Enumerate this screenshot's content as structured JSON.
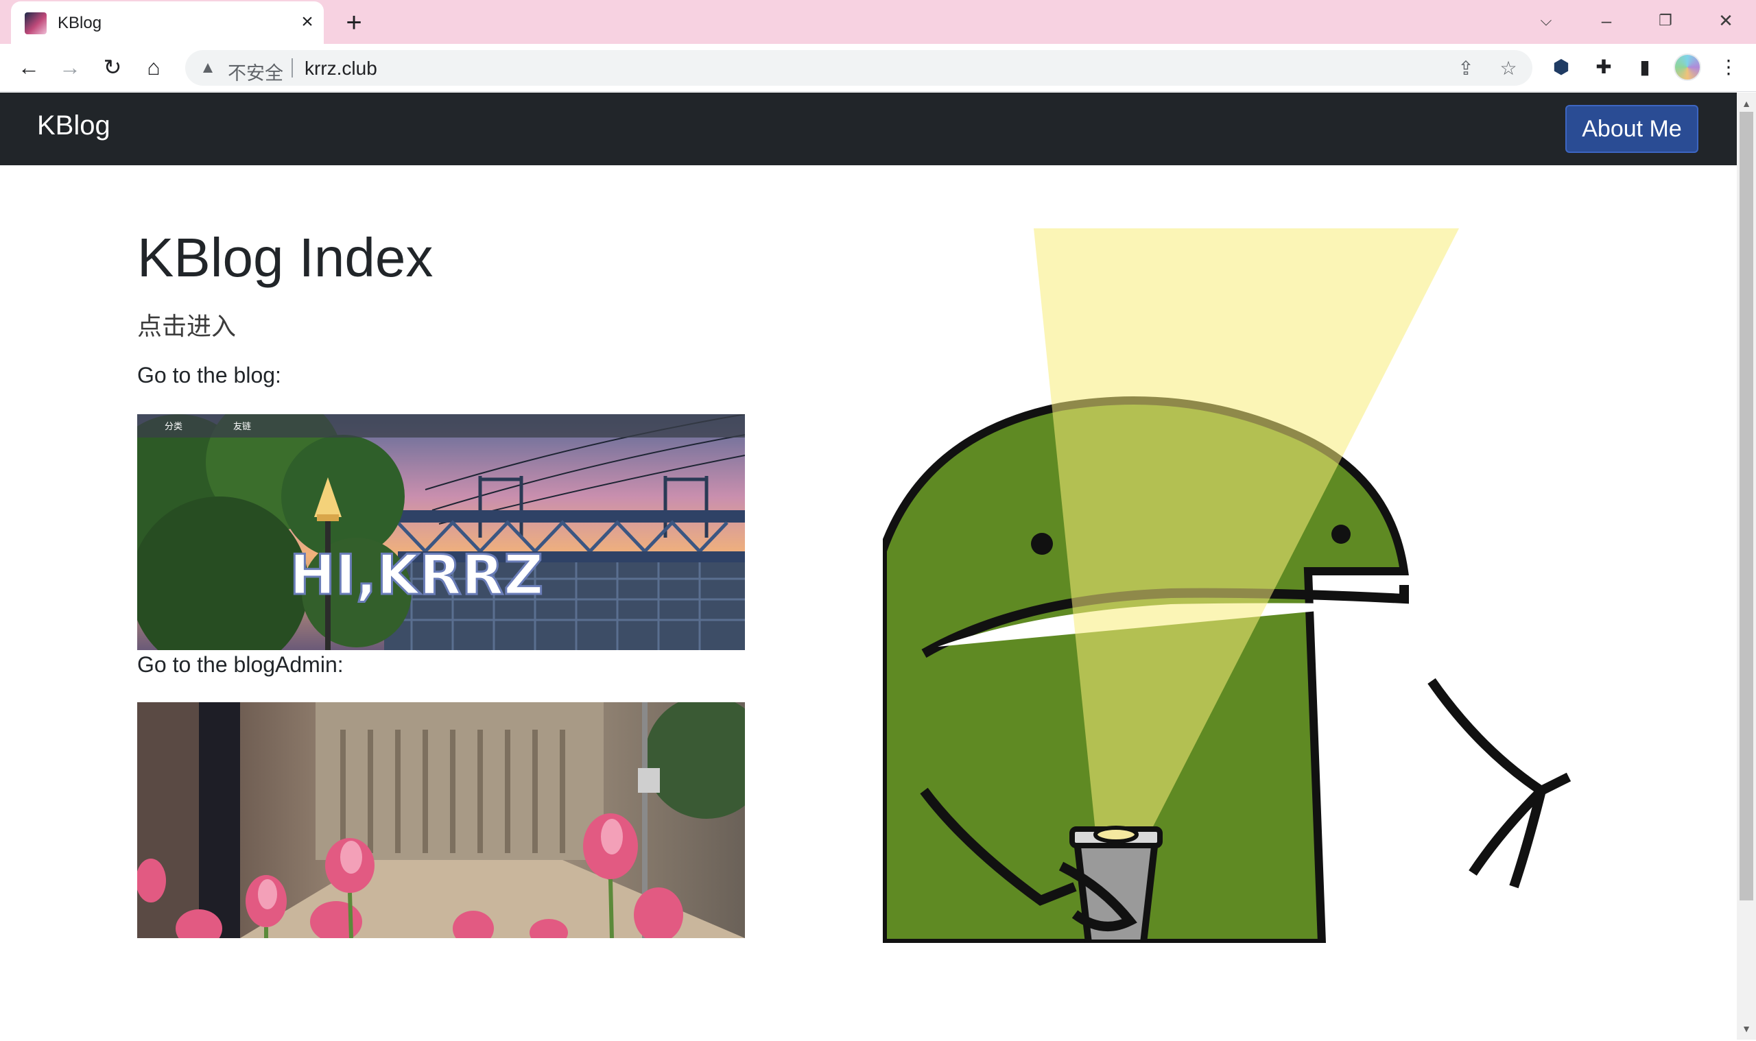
{
  "browser": {
    "tab": {
      "title": "KBlog",
      "close_icon": "close-icon"
    },
    "new_tab_icon": "plus-icon",
    "window_controls": [
      "chevron-down-icon",
      "minimize-icon",
      "restore-icon",
      "close-icon"
    ],
    "nav_icons": [
      "back-icon",
      "forward-icon",
      "reload-icon",
      "home-icon"
    ],
    "omnibox": {
      "security_label": "不安全",
      "url": "krrz.club"
    },
    "toolbar_icons": [
      "share-icon",
      "star-icon",
      "extension-shield-icon",
      "puzzle-icon",
      "side-panel-icon",
      "profile-avatar",
      "more-menu-icon"
    ]
  },
  "page": {
    "navbar": {
      "brand": "KBlog",
      "about_button": "About Me",
      "colors": {
        "bg": "#212529",
        "button": "#2a4c94"
      }
    },
    "main": {
      "title": "KBlog Index",
      "subtitle": "点击进入",
      "blog_link_label": "Go to the blog:",
      "blog_card": {
        "menu_items": [
          "分类",
          "友链"
        ],
        "banner_text": "HI,KRRZ"
      },
      "admin_link_label": "Go to the blogAdmin:"
    }
  }
}
